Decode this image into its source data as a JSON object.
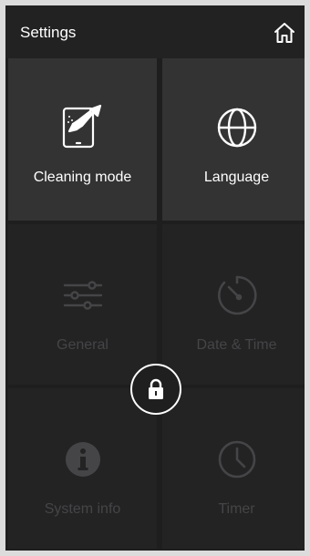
{
  "header": {
    "title": "Settings"
  },
  "tiles": {
    "cleaning": {
      "label": "Cleaning mode",
      "icon": "cleaning-tablet-brush-icon",
      "state": "active"
    },
    "language": {
      "label": "Language",
      "icon": "globe-icon",
      "state": "active"
    },
    "general": {
      "label": "General",
      "icon": "sliders-icon",
      "state": "locked"
    },
    "datetime": {
      "label": "Date & Time",
      "icon": "dial-clock-icon",
      "state": "locked"
    },
    "sysinfo": {
      "label": "System info",
      "icon": "info-icon",
      "state": "locked"
    },
    "timer": {
      "label": "Timer",
      "icon": "clock-icon",
      "state": "locked"
    }
  },
  "lock_button": {
    "icon": "padlock-icon"
  },
  "colors": {
    "background": "#1e1e1f",
    "active_tile": "#333334",
    "locked_tile": "#232324",
    "locked_text": "#454547",
    "text": "#ffffff"
  }
}
